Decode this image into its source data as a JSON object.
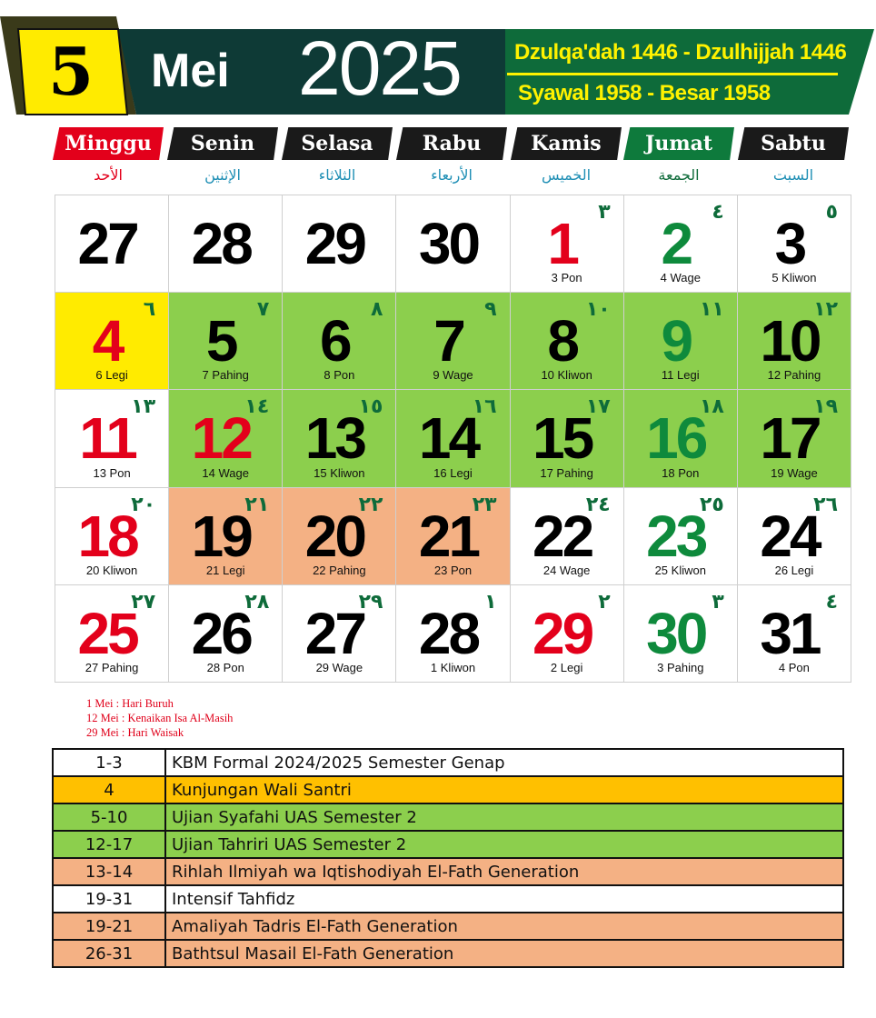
{
  "header": {
    "day": "5",
    "month": "Mei",
    "year": "2025",
    "hijri": "Dzulqa'dah 1446 - Dzulhijjah 1446",
    "javanese": "Syawal 1958 - Besar 1958"
  },
  "weekdays": [
    {
      "label": "Minggu",
      "arabic": "الأحد",
      "style": "red"
    },
    {
      "label": "Senin",
      "arabic": "الإثنين",
      "style": "dark"
    },
    {
      "label": "Selasa",
      "arabic": "الثلاثاء",
      "style": "dark"
    },
    {
      "label": "Rabu",
      "arabic": "الأربعاء",
      "style": "dark"
    },
    {
      "label": "Kamis",
      "arabic": "الخميس",
      "style": "dark"
    },
    {
      "label": "Jumat",
      "arabic": "الجمعة",
      "style": "green"
    },
    {
      "label": "Sabtu",
      "arabic": "السبت",
      "style": "dark"
    }
  ],
  "colors": {
    "red": "#e3001b",
    "green": "#0e8a3c",
    "black": "#000000",
    "highlight_yellow": "#ffeb00",
    "highlight_green": "#8ccf4d",
    "highlight_salmon": "#f4b184",
    "agenda_orange": "#ffc000",
    "header_dark": "#0e3a36",
    "header_green": "#0e6b3a"
  },
  "calendar": {
    "rows": [
      [
        {
          "day": "27",
          "hijri": "",
          "pasaran": "",
          "color": "black",
          "bg": "white"
        },
        {
          "day": "28",
          "hijri": "",
          "pasaran": "",
          "color": "black",
          "bg": "white"
        },
        {
          "day": "29",
          "hijri": "",
          "pasaran": "",
          "color": "black",
          "bg": "white"
        },
        {
          "day": "30",
          "hijri": "",
          "pasaran": "",
          "color": "black",
          "bg": "white"
        },
        {
          "day": "1",
          "hijri": "٣",
          "pasaran": "3 Pon",
          "color": "red",
          "bg": "white"
        },
        {
          "day": "2",
          "hijri": "٤",
          "pasaran": "4 Wage",
          "color": "green",
          "bg": "white"
        },
        {
          "day": "3",
          "hijri": "٥",
          "pasaran": "5 Kliwon",
          "color": "black",
          "bg": "white"
        }
      ],
      [
        {
          "day": "4",
          "hijri": "٦",
          "pasaran": "6 Legi",
          "color": "red",
          "bg": "yellow"
        },
        {
          "day": "5",
          "hijri": "٧",
          "pasaran": "7 Pahing",
          "color": "black",
          "bg": "green"
        },
        {
          "day": "6",
          "hijri": "٨",
          "pasaran": "8 Pon",
          "color": "black",
          "bg": "green"
        },
        {
          "day": "7",
          "hijri": "٩",
          "pasaran": "9 Wage",
          "color": "black",
          "bg": "green"
        },
        {
          "day": "8",
          "hijri": "١٠",
          "pasaran": "10 Kliwon",
          "color": "black",
          "bg": "green"
        },
        {
          "day": "9",
          "hijri": "١١",
          "pasaran": "11 Legi",
          "color": "green",
          "bg": "green"
        },
        {
          "day": "10",
          "hijri": "١٢",
          "pasaran": "12 Pahing",
          "color": "black",
          "bg": "green"
        }
      ],
      [
        {
          "day": "11",
          "hijri": "١٣",
          "pasaran": "13 Pon",
          "color": "red",
          "bg": "white"
        },
        {
          "day": "12",
          "hijri": "١٤",
          "pasaran": "14 Wage",
          "color": "red",
          "bg": "green"
        },
        {
          "day": "13",
          "hijri": "١٥",
          "pasaran": "15 Kliwon",
          "color": "black",
          "bg": "green"
        },
        {
          "day": "14",
          "hijri": "١٦",
          "pasaran": "16 Legi",
          "color": "black",
          "bg": "green"
        },
        {
          "day": "15",
          "hijri": "١٧",
          "pasaran": "17 Pahing",
          "color": "black",
          "bg": "green"
        },
        {
          "day": "16",
          "hijri": "١٨",
          "pasaran": "18 Pon",
          "color": "green",
          "bg": "green"
        },
        {
          "day": "17",
          "hijri": "١٩",
          "pasaran": "19 Wage",
          "color": "black",
          "bg": "green"
        }
      ],
      [
        {
          "day": "18",
          "hijri": "٢٠",
          "pasaran": "20 Kliwon",
          "color": "red",
          "bg": "white"
        },
        {
          "day": "19",
          "hijri": "٢١",
          "pasaran": "21 Legi",
          "color": "black",
          "bg": "salmon"
        },
        {
          "day": "20",
          "hijri": "٢٢",
          "pasaran": "22 Pahing",
          "color": "black",
          "bg": "salmon"
        },
        {
          "day": "21",
          "hijri": "٢٣",
          "pasaran": "23 Pon",
          "color": "black",
          "bg": "salmon"
        },
        {
          "day": "22",
          "hijri": "٢٤",
          "pasaran": "24 Wage",
          "color": "black",
          "bg": "white"
        },
        {
          "day": "23",
          "hijri": "٢٥",
          "pasaran": "25 Kliwon",
          "color": "green",
          "bg": "white"
        },
        {
          "day": "24",
          "hijri": "٢٦",
          "pasaran": "26 Legi",
          "color": "black",
          "bg": "white"
        }
      ],
      [
        {
          "day": "25",
          "hijri": "٢٧",
          "pasaran": "27 Pahing",
          "color": "red",
          "bg": "white"
        },
        {
          "day": "26",
          "hijri": "٢٨",
          "pasaran": "28 Pon",
          "color": "black",
          "bg": "white"
        },
        {
          "day": "27",
          "hijri": "٢٩",
          "pasaran": "29 Wage",
          "color": "black",
          "bg": "white"
        },
        {
          "day": "28",
          "hijri": "١",
          "pasaran": "1 Kliwon",
          "color": "black",
          "bg": "white"
        },
        {
          "day": "29",
          "hijri": "٢",
          "pasaran": "2 Legi",
          "color": "red",
          "bg": "white"
        },
        {
          "day": "30",
          "hijri": "٣",
          "pasaran": "3 Pahing",
          "color": "green",
          "bg": "white"
        },
        {
          "day": "31",
          "hijri": "٤",
          "pasaran": "4 Pon",
          "color": "black",
          "bg": "white"
        }
      ]
    ]
  },
  "holidays": [
    {
      "text": "1 Mei   : Hari Buruh"
    },
    {
      "text": "12 Mei   : Kenaikan Isa Al-Masih"
    },
    {
      "text": "29 Mei   : Hari Waisak"
    }
  ],
  "agenda": [
    {
      "date": "1-3",
      "event": "KBM Formal 2024/2025 Semester Genap",
      "bg": "white"
    },
    {
      "date": "4",
      "event": "Kunjungan Wali Santri",
      "bg": "orange"
    },
    {
      "date": "5-10",
      "event": "Ujian Syafahi UAS Semester 2",
      "bg": "green"
    },
    {
      "date": "12-17",
      "event": "Ujian Tahriri UAS Semester 2",
      "bg": "green"
    },
    {
      "date": "13-14",
      "event": "Rihlah Ilmiyah wa Iqtishodiyah El-Fath Generation",
      "bg": "salmon"
    },
    {
      "date": "19-31",
      "event": "Intensif  Tahfidz",
      "bg": "white"
    },
    {
      "date": "19-21",
      "event": "Amaliyah Tadris El-Fath Generation",
      "bg": "salmon"
    },
    {
      "date": "26-31",
      "event": "Bathtsul Masail El-Fath Generation",
      "bg": "salmon"
    }
  ]
}
